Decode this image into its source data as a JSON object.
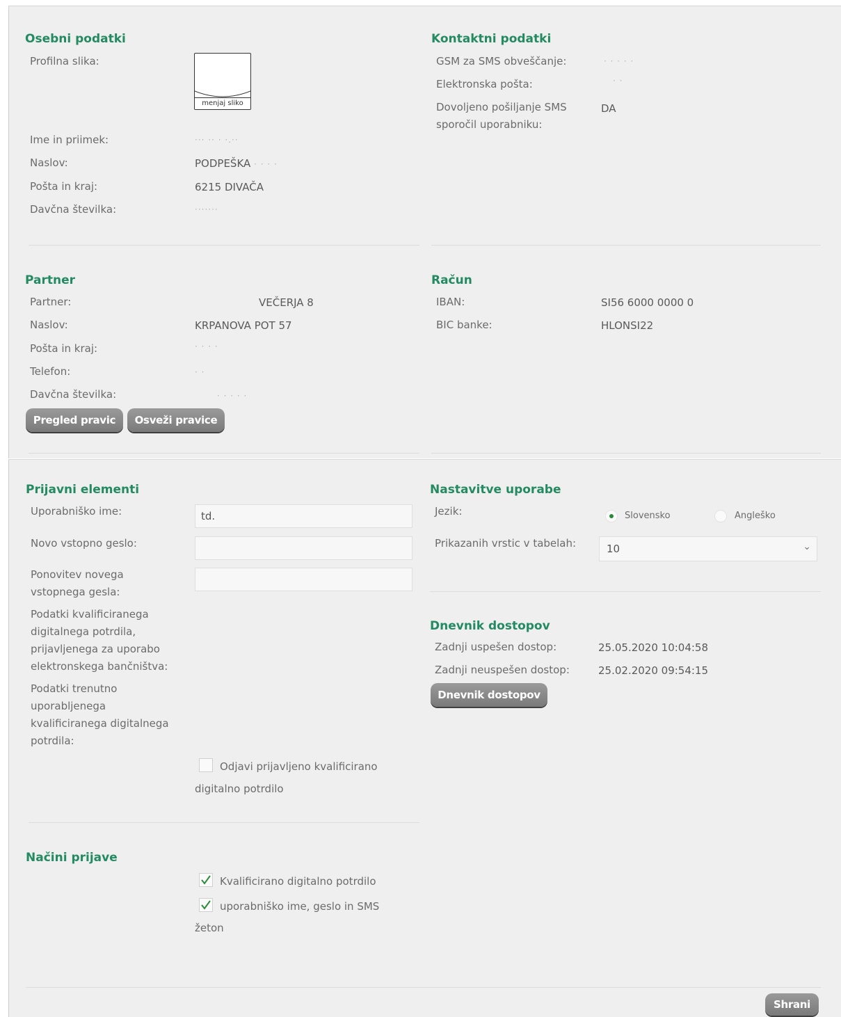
{
  "personal": {
    "heading": "Osebni podatki",
    "profile_label": "Profilna slika:",
    "change_picture": "menjaj sliko",
    "name_label": "Ime in priimek:",
    "name_value": "··· ·· · ·.··",
    "address_label": "Naslov:",
    "address_value": "PODPEŠKA",
    "address_masked": "· · · ·",
    "post_label": "Pošta in kraj:",
    "post_value": "6215 DIVAČA",
    "tax_label": "Davčna številka:",
    "tax_value": "·······"
  },
  "contact": {
    "heading": "Kontaktni podatki",
    "gsm_label": "GSM za SMS obveščanje:",
    "gsm_value": "· · · · ·",
    "email_label": "Elektronska pošta:",
    "email_value": "· ·",
    "sms_label": "Dovoljeno pošiljanje SMS sporočil uporabniku:",
    "sms_value": "DA"
  },
  "partner": {
    "heading": "Partner",
    "partner_label": "Partner:",
    "partner_value": "VEČERJA 8",
    "address_label": "Naslov:",
    "address_value": "KRPANOVA POT 57",
    "post_label": "Pošta in kraj:",
    "post_value": "· · · ·",
    "phone_label": "Telefon:",
    "phone_value": "· ·",
    "tax_label": "Davčna številka:",
    "tax_value": "· · · · ·",
    "btn_rights": "Pregled pravic",
    "btn_refresh": "Osveži pravice"
  },
  "account": {
    "heading": "Račun",
    "iban_label": "IBAN:",
    "iban_value": "SI56 6000 0000 0",
    "bic_label": "BIC banke:",
    "bic_value": "HLONSI22"
  },
  "login": {
    "heading": "Prijavni elementi",
    "username_label": "Uporabniško ime:",
    "username_value": "td.",
    "new_password_label": "Novo vstopno geslo:",
    "repeat_password_label": "Ponovitev novega vstopnega gesla:",
    "cert_registered_label": "Podatki kvalificiranega digitalnega potrdila, prijavljenega za uporabo elektronskega bančništva:",
    "cert_current_label": "Podatki trenutno uporabljenega kvalificiranega digitalnega potrdila:",
    "logout_cert_label_1": "Odjavi prijavljeno kvalificirano",
    "logout_cert_label_2": "digitalno potrdilo"
  },
  "settings": {
    "heading": "Nastavitve uporabe",
    "language_label": "Jezik:",
    "lang_slovenian": "Slovensko",
    "lang_english": "Angleško",
    "rows_label": "Prikazanih vrstic v tabelah:",
    "rows_value": "10"
  },
  "access_log": {
    "heading": "Dnevnik dostopov",
    "last_success_label": "Zadnji uspešen dostop:",
    "last_success_value": "25.05.2020 10:04:58",
    "last_fail_label": "Zadnji neuspešen dostop:",
    "last_fail_value": "25.02.2020 09:54:15",
    "btn_log": "Dnevnik dostopov"
  },
  "login_methods": {
    "heading": "Načini prijave",
    "cert_label": "Kvalificirano digitalno potrdilo",
    "sms_label_1": "uporabniško ime, geslo in SMS",
    "sms_label_2": "žeton"
  },
  "save_label": "Shrani",
  "colors": {
    "heading": "#238a62",
    "panel": "#efefef",
    "button": "#8a8a8a",
    "checkmark": "#2a8a3a"
  }
}
